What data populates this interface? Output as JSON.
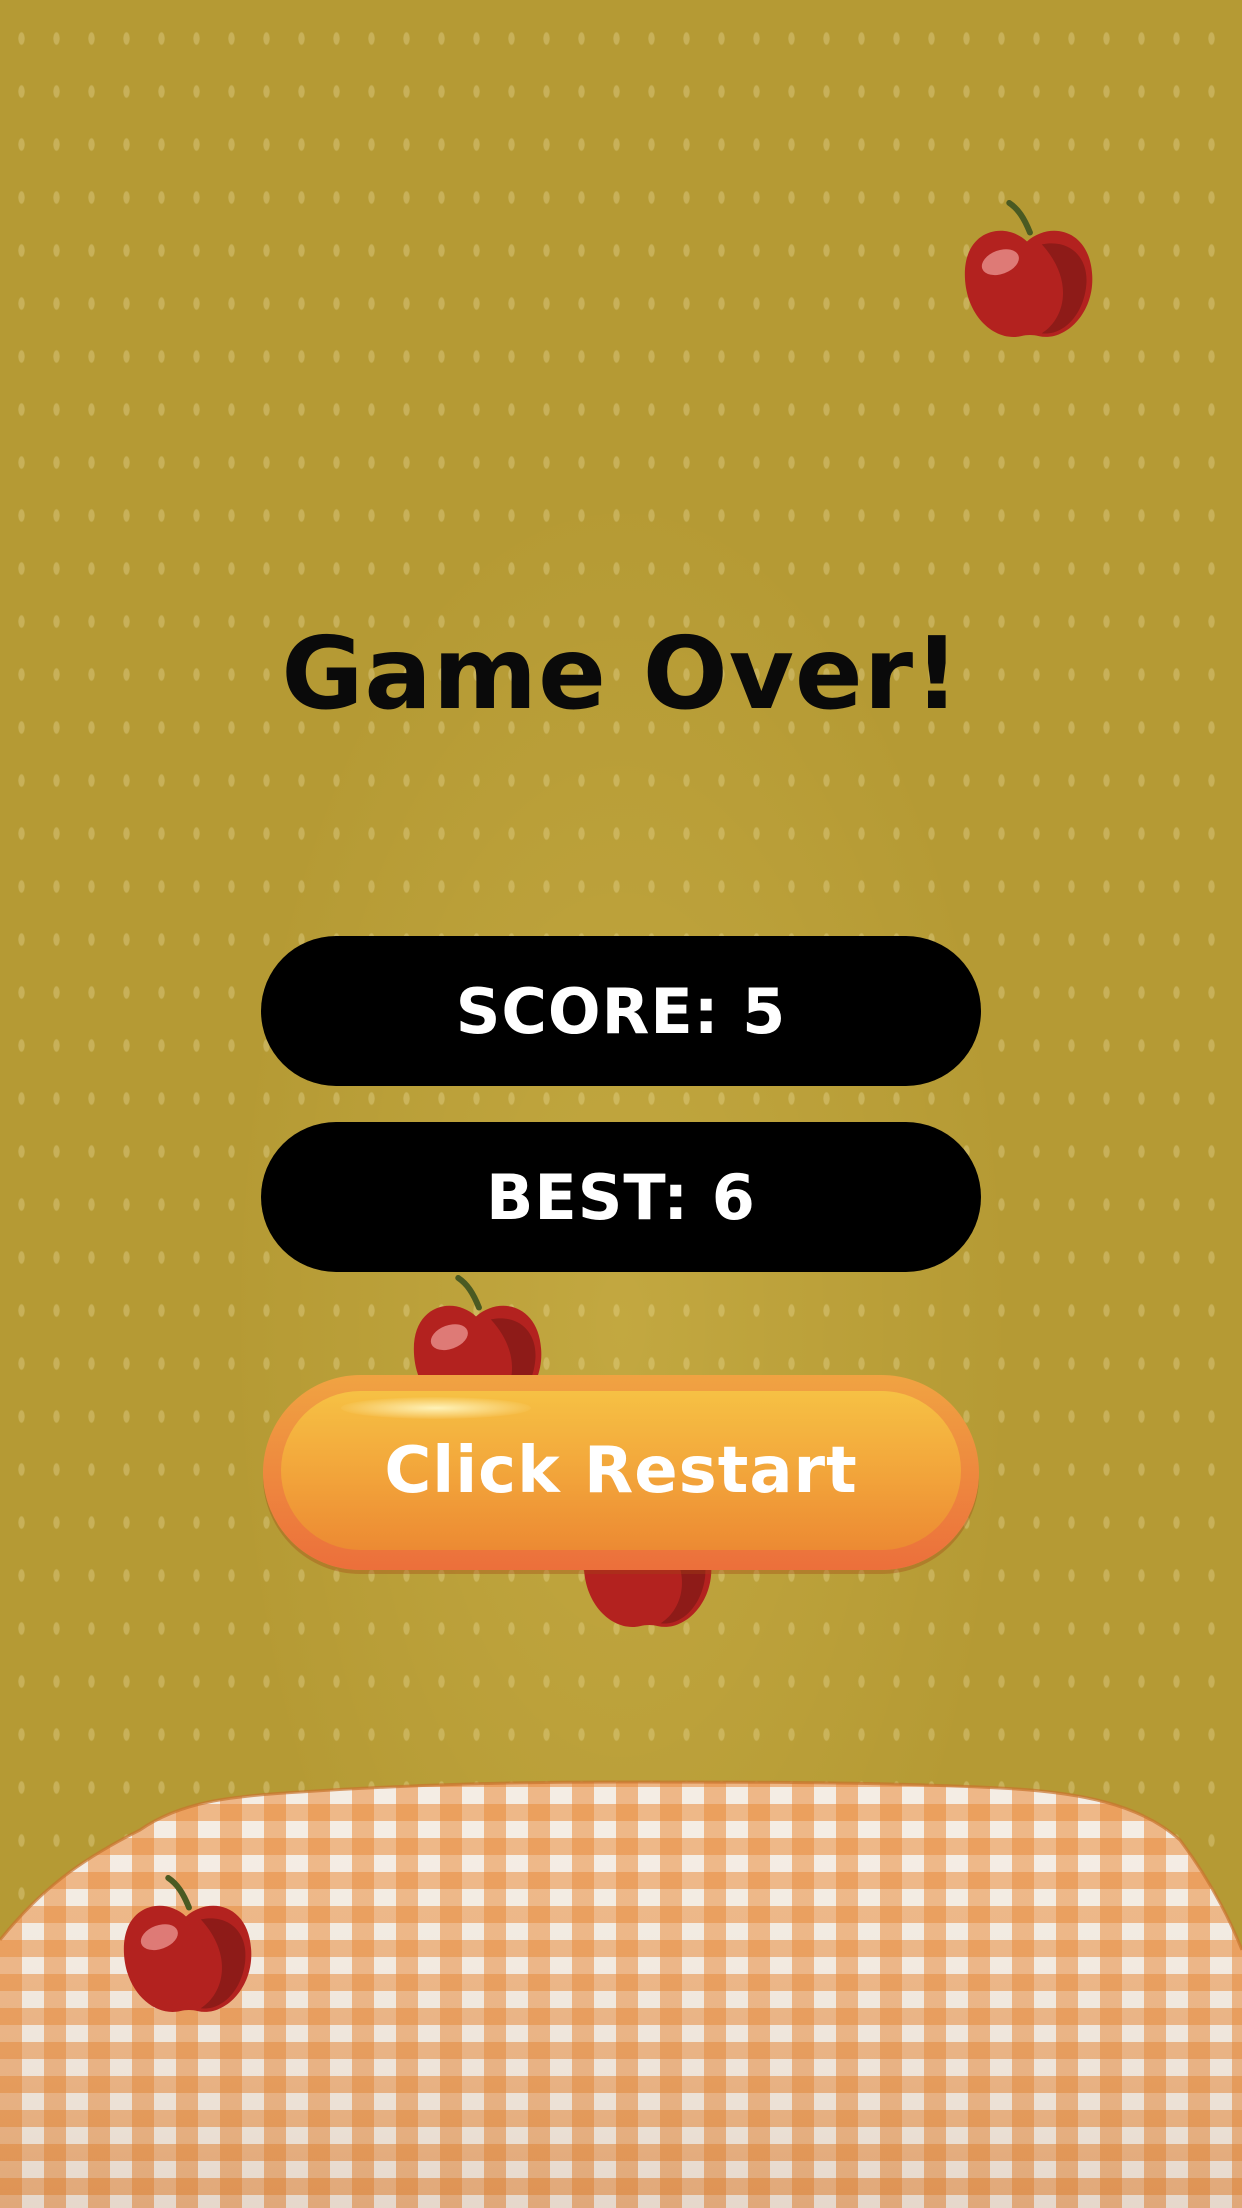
{
  "game": {
    "title": "Game Over!",
    "score_text": "SCORE: 5",
    "best_text": "BEST: 6",
    "restart_label": "Click Restart"
  },
  "stats": {
    "score": 5,
    "best": 6
  },
  "colors": {
    "background": "#b59a34",
    "pill": "#000000",
    "button_top": "#f6c144",
    "button_bottom": "#ec8a33",
    "apple": "#b3221f",
    "blanket_check": "#e88a3a"
  },
  "icons": [
    "apple-icon",
    "picnic-blanket"
  ]
}
